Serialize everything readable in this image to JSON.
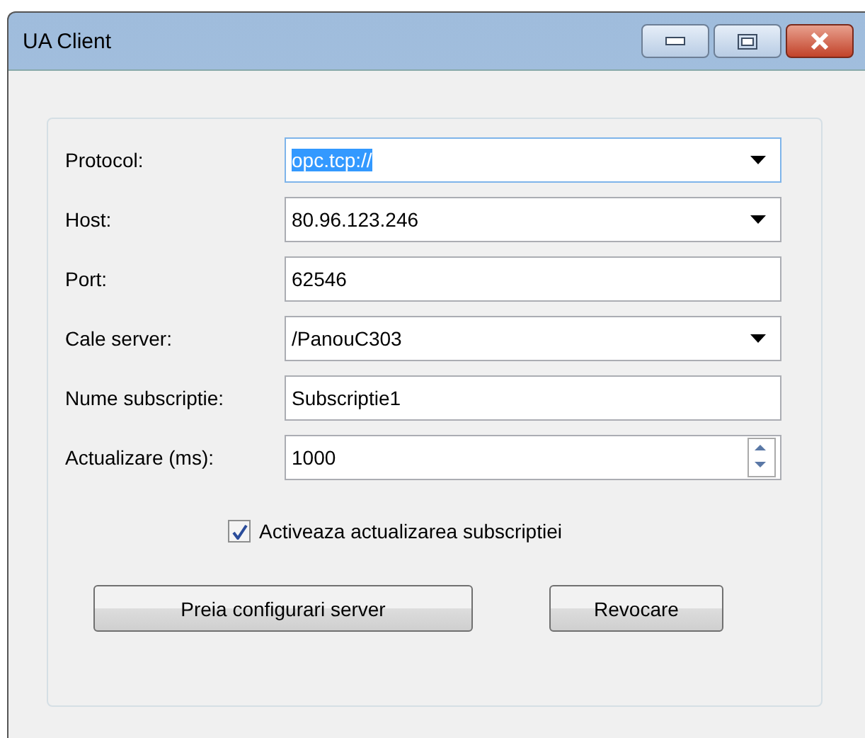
{
  "window": {
    "title": "UA Client"
  },
  "fields": [
    {
      "label": "Protocol:",
      "kind": "combo",
      "value": "opc.tcp://",
      "highlighted": true
    },
    {
      "label": "Host:",
      "kind": "combo",
      "value": "80.96.123.246",
      "highlighted": false
    },
    {
      "label": "Port:",
      "kind": "text",
      "value": "62546",
      "highlighted": false
    },
    {
      "label": "Cale server:",
      "kind": "combo",
      "value": "/PanouC303",
      "highlighted": false
    },
    {
      "label": "Nume subscriptie:",
      "kind": "text",
      "value": "Subscriptie1",
      "highlighted": false
    },
    {
      "label": "Actualizare (ms):",
      "kind": "spin",
      "value": "1000",
      "highlighted": false
    }
  ],
  "checkbox": {
    "label": "Activeaza actualizarea subscriptiei",
    "checked": true
  },
  "buttons": [
    "Preia configurari server",
    "Revocare"
  ]
}
